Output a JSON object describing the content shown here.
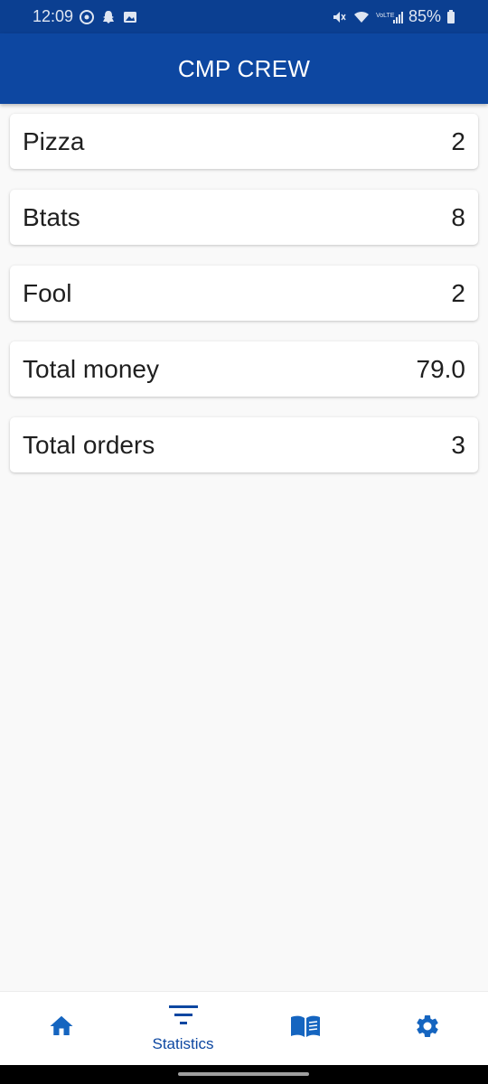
{
  "status_bar": {
    "time": "12:09",
    "battery": "85%"
  },
  "app_bar": {
    "title": "CMP CREW"
  },
  "stats": [
    {
      "label": "Pizza",
      "value": "2"
    },
    {
      "label": "Btats",
      "value": "8"
    },
    {
      "label": "Fool",
      "value": "2"
    },
    {
      "label": "Total money",
      "value": "79.0"
    },
    {
      "label": "Total orders",
      "value": "3"
    }
  ],
  "bottom_nav": {
    "items": [
      {
        "icon": "home-icon",
        "label": ""
      },
      {
        "icon": "filter-icon",
        "label": "Statistics"
      },
      {
        "icon": "book-icon",
        "label": ""
      },
      {
        "icon": "gear-icon",
        "label": ""
      }
    ],
    "active_color": "#0d47a1",
    "icon_color": "#1565c0"
  },
  "colors": {
    "app_bar": "#0d47a1",
    "status_bar": "#0b3f91",
    "background": "#f9f9f9"
  }
}
